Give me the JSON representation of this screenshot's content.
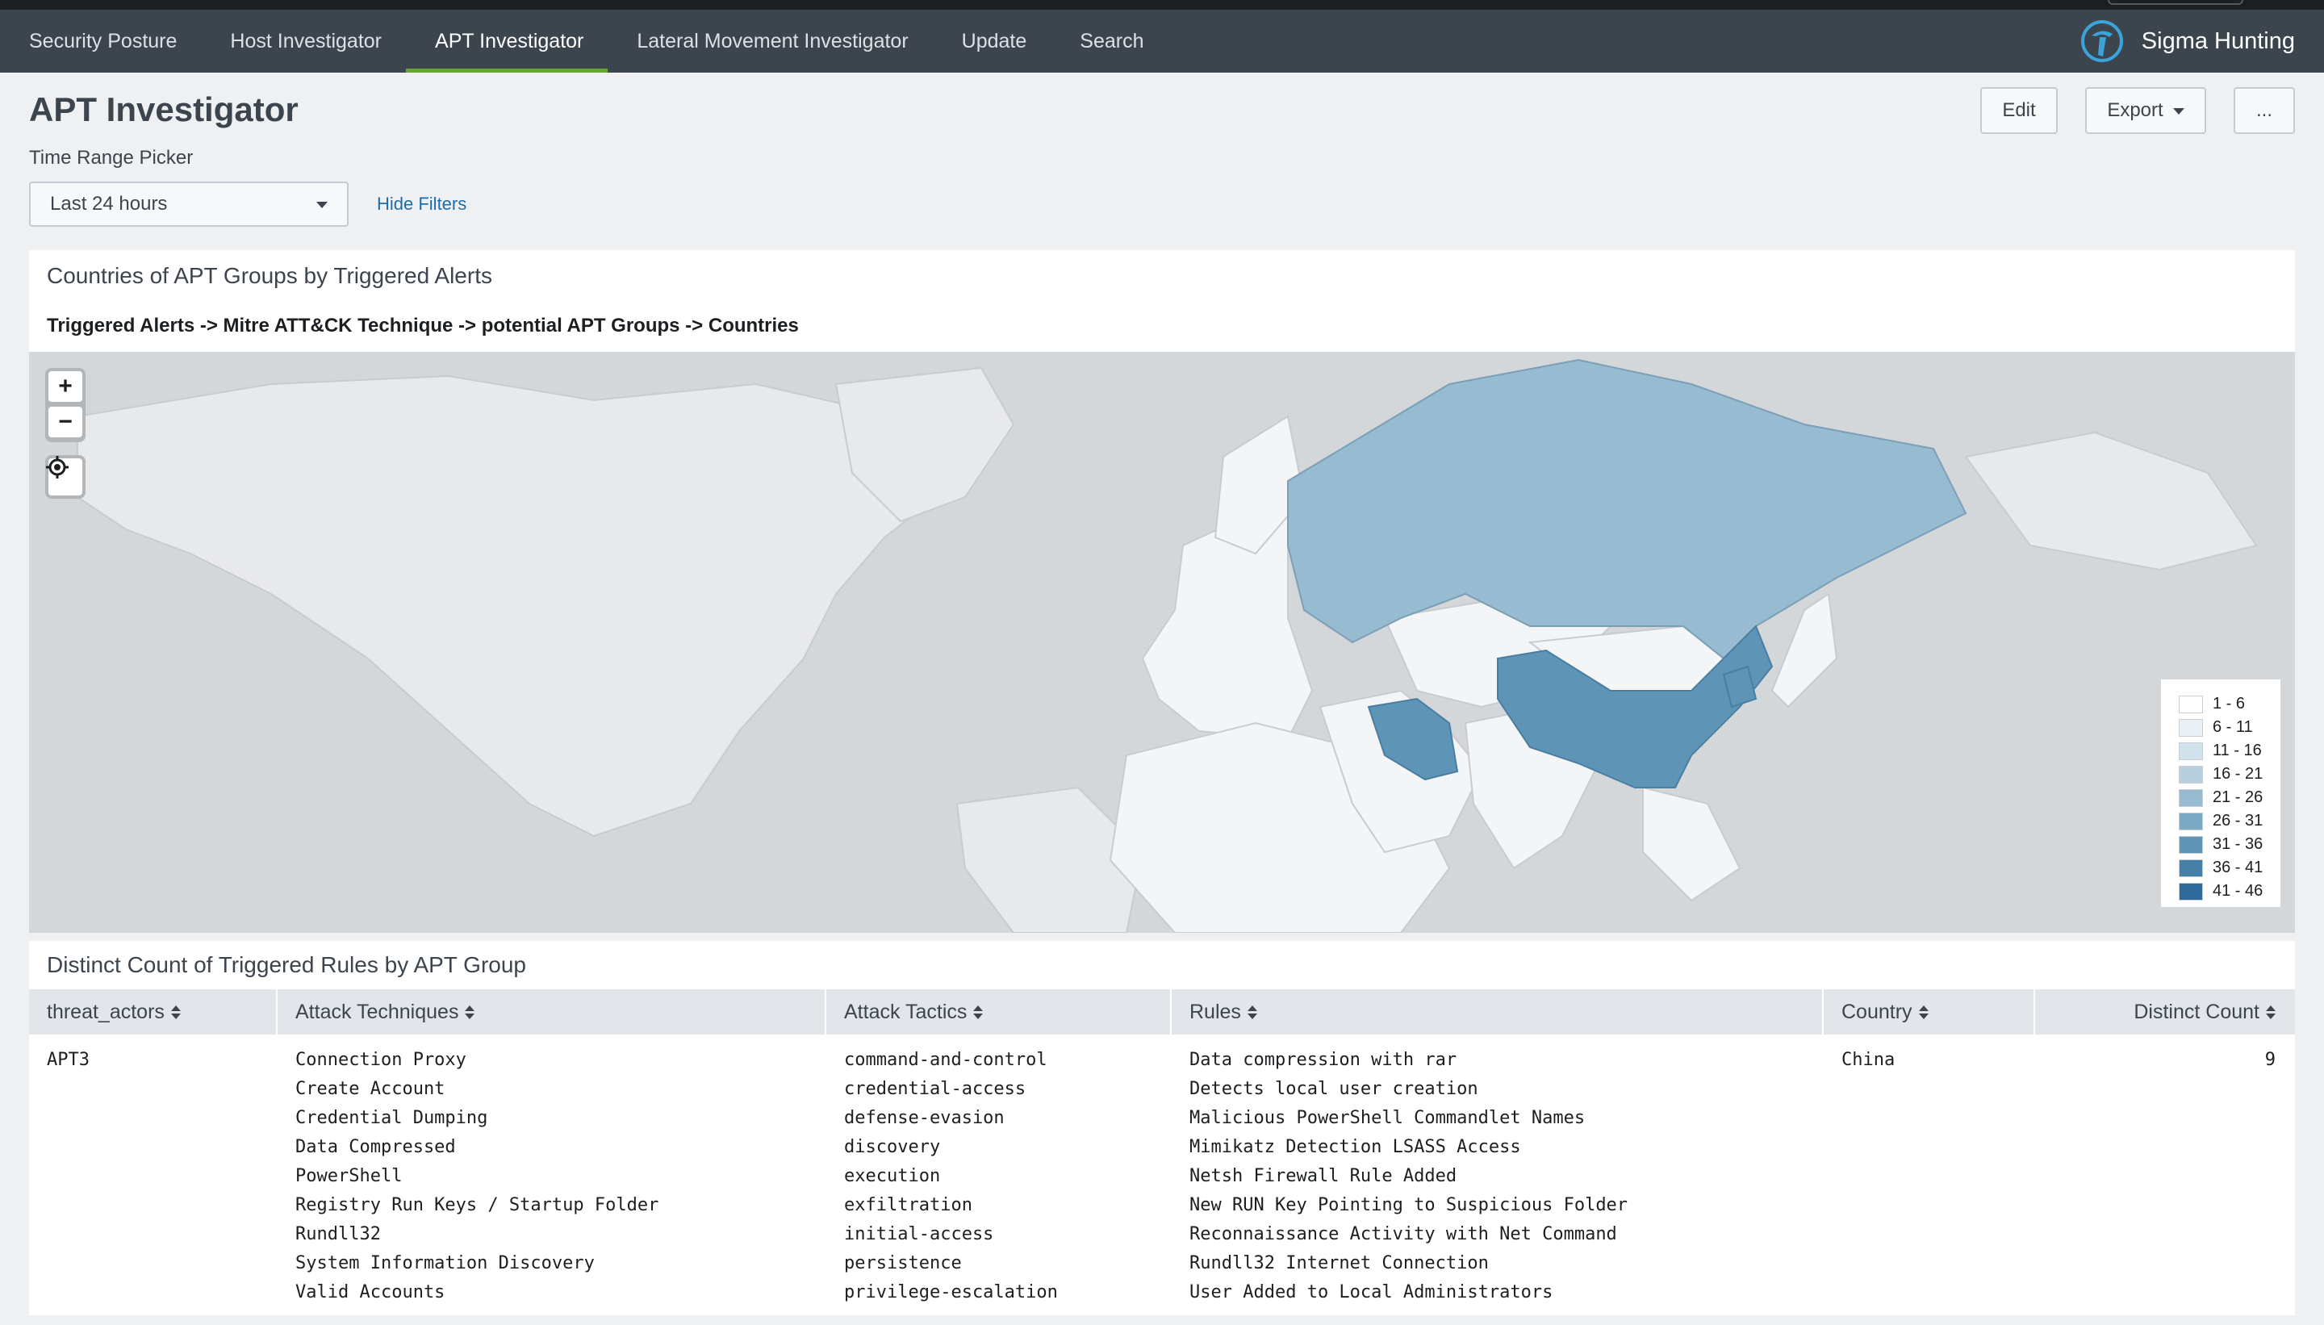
{
  "nav": {
    "tabs": [
      {
        "label": "Security Posture"
      },
      {
        "label": "Host Investigator"
      },
      {
        "label": "APT Investigator"
      },
      {
        "label": "Lateral Movement Investigator"
      },
      {
        "label": "Update"
      },
      {
        "label": "Search"
      }
    ],
    "active_tab": "APT Investigator",
    "app_name": "Sigma Hunting",
    "accent_color": "#65a637"
  },
  "header": {
    "title": "APT Investigator",
    "edit_label": "Edit",
    "export_label": "Export",
    "more_label": "..."
  },
  "filters": {
    "time_label": "Time Range Picker",
    "time_value": "Last 24 hours",
    "hide_label": "Hide Filters"
  },
  "map_panel": {
    "title": "Countries of APT Groups by Triggered Alerts",
    "subtitle": "Triggered Alerts -> Mitre ATT&CK Technique -> potential APT Groups -> Countries",
    "zoom_in": "+",
    "zoom_out": "−",
    "legend": [
      {
        "label": "1 - 6",
        "color": "#ffffff"
      },
      {
        "label": "6 - 11",
        "color": "#e8f0f5"
      },
      {
        "label": "11 - 16",
        "color": "#d0e2ec"
      },
      {
        "label": "16 - 21",
        "color": "#b6d0df"
      },
      {
        "label": "21 - 26",
        "color": "#97bcd1"
      },
      {
        "label": "26 - 31",
        "color": "#7aa9c4"
      },
      {
        "label": "31 - 36",
        "color": "#5e94b6"
      },
      {
        "label": "36 - 41",
        "color": "#4680a8"
      },
      {
        "label": "41 - 46",
        "color": "#2f6a9a"
      }
    ],
    "highlighted_regions": [
      {
        "name": "Russia",
        "range": "21 - 26"
      },
      {
        "name": "China",
        "range": "31 - 36"
      },
      {
        "name": "Iran",
        "range": "31 - 36"
      },
      {
        "name": "North Korea",
        "range": "31 - 36"
      }
    ]
  },
  "table_panel": {
    "title": "Distinct Count of Triggered Rules by APT Group",
    "columns": [
      "threat_actors",
      "Attack Techniques",
      "Attack Tactics",
      "Rules",
      "Country",
      "Distinct Count"
    ],
    "rows": [
      {
        "threat_actors": "APT3",
        "techniques": [
          "Connection Proxy",
          "Create Account",
          "Credential Dumping",
          "Data Compressed",
          "PowerShell",
          "Registry Run Keys / Startup Folder",
          "Rundll32",
          "System Information Discovery",
          "Valid Accounts"
        ],
        "tactics": [
          "command-and-control",
          "credential-access",
          "defense-evasion",
          "discovery",
          "execution",
          "exfiltration",
          "initial-access",
          "persistence",
          "privilege-escalation"
        ],
        "rules": [
          "Data compression with rar",
          "Detects local user creation",
          "Malicious PowerShell Commandlet Names",
          "Mimikatz Detection LSASS Access",
          "Netsh Firewall Rule Added",
          "New RUN Key Pointing to Suspicious Folder",
          "Reconnaissance Activity with Net Command",
          "Rundll32 Internet Connection",
          "User Added to Local Administrators"
        ],
        "country": "China",
        "distinct_count": "9"
      }
    ]
  }
}
